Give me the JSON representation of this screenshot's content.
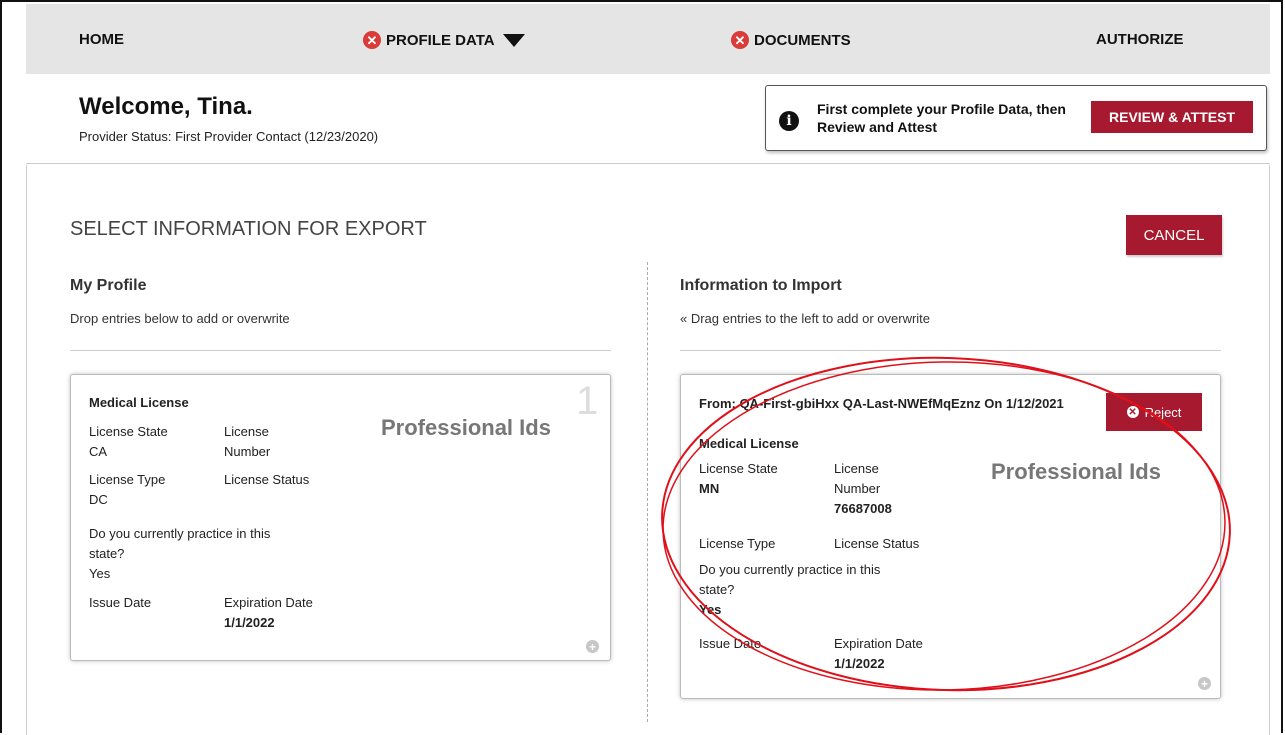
{
  "nav": {
    "home": "HOME",
    "profile_data": "PROFILE DATA",
    "documents": "DOCUMENTS",
    "authorize": "AUTHORIZE"
  },
  "header": {
    "welcome": "Welcome, Tina.",
    "provider_status": "Provider Status:  First Provider Contact (12/23/2020)",
    "notice_text": "First complete your Profile Data, then Review and Attest",
    "review_button": "REVIEW & ATTEST"
  },
  "export": {
    "title": "SELECT INFORMATION FOR EXPORT",
    "cancel_button": "CANCEL"
  },
  "my_profile": {
    "title": "My Profile",
    "subtitle": "Drop entries below to add or overwrite",
    "card": {
      "heading": "Medical License",
      "category": "Professional Ids",
      "number": "1",
      "license_state_label": "License State",
      "license_state_value": "CA",
      "license_number_label_1": "License",
      "license_number_label_2": "Number",
      "license_type_label": "License Type",
      "license_type_value": "DC",
      "license_status_label": "License Status",
      "practice_question_1": "Do you currently practice in this",
      "practice_question_2": "state?",
      "practice_value": "Yes",
      "issue_date_label": "Issue Date",
      "expiration_date_label": "Expiration Date",
      "expiration_date_value": "1/1/2022"
    }
  },
  "import": {
    "title": "Information to Import",
    "subtitle": "« Drag entries to the left to add or overwrite",
    "card": {
      "from": "From: QA-First-gbiHxx QA-Last-NWEfMqEznz On 1/12/2021",
      "reject_button": "Reject",
      "heading": "Medical License",
      "category": "Professional Ids",
      "license_state_label": "License State",
      "license_state_value": "MN",
      "license_number_label_1": "License",
      "license_number_label_2": "Number",
      "license_number_value": "76687008",
      "license_type_label": "License Type",
      "license_status_label": "License Status",
      "practice_question_1": "Do you currently practice in this",
      "practice_question_2": "state?",
      "practice_value": "Yes",
      "issue_date_label": "Issue Date",
      "expiration_date_label": "Expiration Date",
      "expiration_date_value": "1/1/2022"
    }
  },
  "colors": {
    "brand_red": "#a6192e",
    "error_red": "#d93a3a",
    "annotation_red": "#e0101a",
    "nav_bg": "#e5e5e5"
  },
  "icons": {
    "error": "x-circle-icon",
    "dropdown": "caret-down-icon",
    "info": "info-icon",
    "add": "plus-circle-icon",
    "reject": "x-circle-icon"
  }
}
